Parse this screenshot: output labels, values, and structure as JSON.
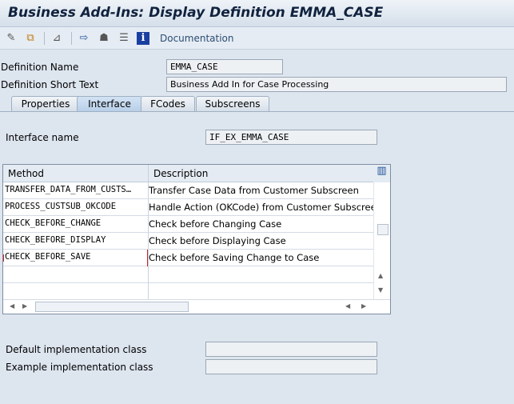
{
  "title": "Business Add-Ins: Display Definition EMMA_CASE",
  "toolbar": {
    "icons": [
      "change-display-icon",
      "other-object-icon",
      "hierarchy-icon",
      "navigate-icon",
      "tree-icon",
      "list-icon",
      "info-icon"
    ],
    "documentation": "Documentation"
  },
  "header": {
    "definition_name_label": "Definition Name",
    "definition_name": "EMMA_CASE",
    "short_text_label": "Definition Short Text",
    "short_text": "Business Add In for Case Processing"
  },
  "tabs": [
    {
      "label": "Properties"
    },
    {
      "label": "Interface",
      "active": true
    },
    {
      "label": "FCodes"
    },
    {
      "label": "Subscreens"
    }
  ],
  "interface": {
    "name_label": "Interface name",
    "name": "IF_EX_EMMA_CASE"
  },
  "table": {
    "columns": [
      "Method",
      "Description"
    ],
    "rows": [
      {
        "method": "TRANSFER_DATA_FROM_CUSTS…",
        "description": "Transfer Case Data from Customer Subscreen"
      },
      {
        "method": "PROCESS_CUSTSUB_OKCODE",
        "description": "Handle Action (OKCode) from Customer Subscreen"
      },
      {
        "method": "CHECK_BEFORE_CHANGE",
        "description": "Check before Changing Case"
      },
      {
        "method": "CHECK_BEFORE_DISPLAY",
        "description": "Check before Displaying Case"
      },
      {
        "method": "CHECK_BEFORE_SAVE",
        "description": "Check before Saving Change to Case"
      }
    ]
  },
  "impl": {
    "default_label": "Default implementation class",
    "default_value": "",
    "example_label": "Example implementation class",
    "example_value": ""
  }
}
